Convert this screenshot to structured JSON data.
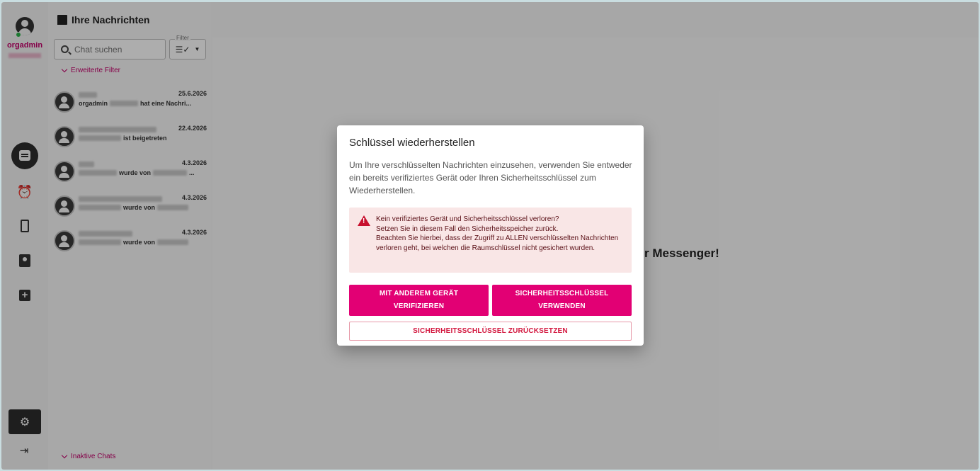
{
  "user": {
    "name": "orgadmin"
  },
  "panel": {
    "title": "Ihre Nachrichten",
    "search_placeholder": "Chat suchen",
    "filter_label": "Filter",
    "extended_filter": "Erweiterte Filter",
    "inactive_chats": "Inaktive Chats"
  },
  "chats": [
    {
      "date": "25.6.2026",
      "preview_start": "orgadmin",
      "preview_end": "hat eine Nachri...",
      "type": "group"
    },
    {
      "date": "22.4.2026",
      "preview_start": "",
      "preview_end": "ist beigetreten",
      "type": "group"
    },
    {
      "date": "4.3.2026",
      "preview_start": "",
      "preview_end": "wurde von",
      "preview_tail": "...",
      "type": "group"
    },
    {
      "date": "4.3.2026",
      "preview_start": "",
      "preview_end": "wurde von",
      "type": "person"
    },
    {
      "date": "4.3.2026",
      "preview_start": "",
      "preview_end": "wurde von",
      "type": "person"
    }
  ],
  "main": {
    "welcome_partial": "r Messenger!"
  },
  "dialog": {
    "title": "Schlüssel wiederherstellen",
    "text": "Um Ihre verschlüsselten Nachrichten einzusehen, verwenden Sie entweder ein bereits verifiziertes Gerät oder Ihren Sicherheitsschlüssel zum Wiederherstellen.",
    "warning_line1": "Kein verifiziertes Gerät und Sicherheitsschlüssel verloren?",
    "warning_line2": "Setzen Sie in diesem Fall den Sicherheitsspeicher zurück.",
    "warning_line3": "Beachten Sie hierbei, dass der Zugriff zu ALLEN verschlüsselten Nachrichten verloren geht, bei welchen die Raumschlüssel nicht gesichert wurden.",
    "btn_verify_line1": "MIT ANDEREM GERÄT",
    "btn_verify_line2": "VERIFIZIEREN",
    "btn_key_line1": "SICHERHEITSSCHLÜSSEL",
    "btn_key_line2": "VERWENDEN",
    "btn_reset": "SICHERHEITSSCHLÜSSEL ZURÜCKSETZEN"
  },
  "colors": {
    "brand": "#e20074",
    "warning_bg": "#f9e6e6",
    "warning_icon": "#c8102e"
  }
}
